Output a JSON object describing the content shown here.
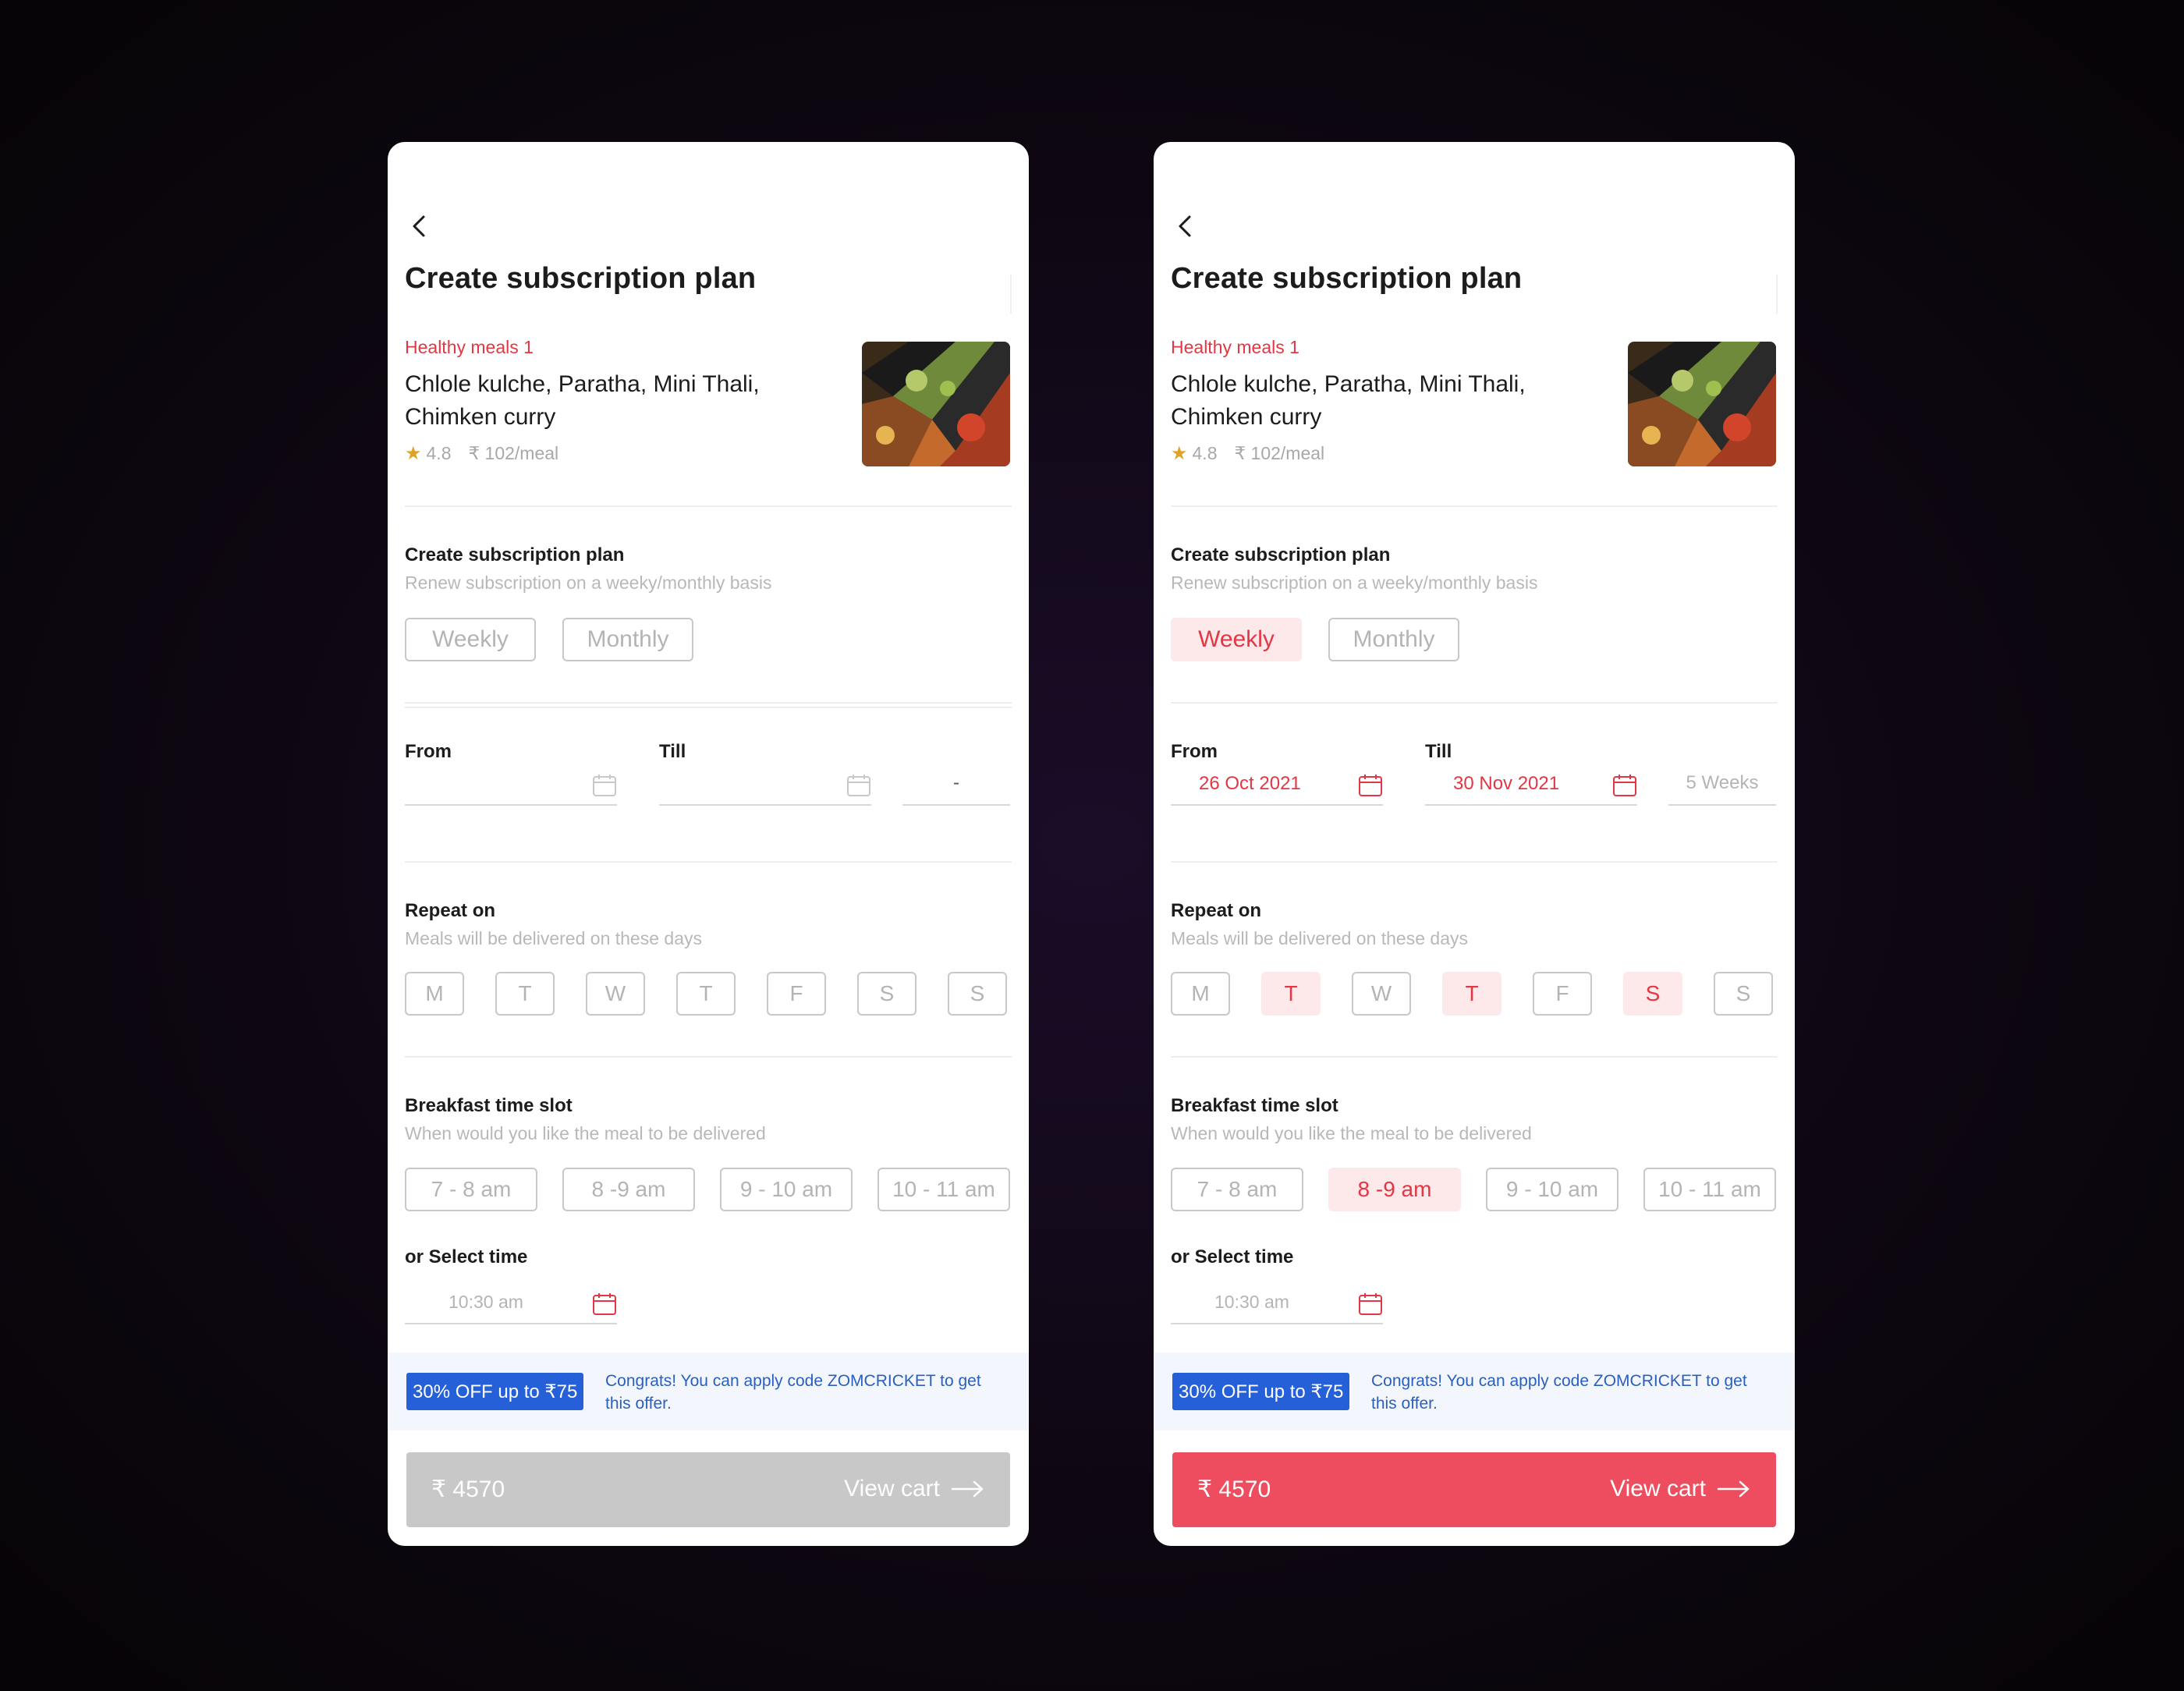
{
  "screen": {
    "title": "Create subscription plan",
    "meal": {
      "tag": "Healthy meals 1",
      "name": "Chlole kulche, Paratha, Mini Thali, Chimken curry",
      "rating": "4.8",
      "price": "₹ 102/meal"
    },
    "plan_section": {
      "title": "Create subscription plan",
      "subtitle": "Renew subscription on a weeky/monthly basis",
      "options": [
        "Weekly",
        "Monthly"
      ]
    },
    "date_section": {
      "from_label": "From",
      "till_label": "Till"
    },
    "repeat_section": {
      "title": "Repeat on",
      "subtitle": "Meals will be delivered on these days",
      "days": [
        "M",
        "T",
        "W",
        "T",
        "F",
        "S",
        "S"
      ]
    },
    "slot_section": {
      "title": "Breakfast time slot",
      "subtitle": "When would you like the meal to be delivered",
      "slots": [
        "7 - 8 am",
        "8 -9 am",
        "9 - 10 am",
        "10 - 11 am"
      ],
      "or_select_label": "or Select time",
      "time_value": "10:30 am"
    },
    "offer": {
      "badge": "30% OFF up to ₹75",
      "message": "Congrats! You can apply code ZOMCRICKET to get this offer."
    },
    "cart": {
      "price": "₹ 4570",
      "cta": "View cart"
    }
  },
  "left_state": {
    "from_value": "",
    "till_value": "",
    "duration": "-",
    "selected_plan": null,
    "selected_days": [],
    "selected_slot": null,
    "cart_enabled": false
  },
  "right_state": {
    "from_value": "26 Oct 2021",
    "till_value": "30 Nov 2021",
    "duration": "5 Weeks",
    "selected_plan": "Weekly",
    "selected_days": [
      1,
      3,
      5
    ],
    "selected_slot": 1,
    "cart_enabled": true
  },
  "colors": {
    "accent": "#e23744",
    "accent_bg": "#fde8ea",
    "cart_enabled": "#ee4d5f",
    "cart_disabled": "#c8c8c8",
    "offer_badge": "#2560d8",
    "offer_text": "#2a5fbf",
    "rating_star": "#e0a425"
  }
}
